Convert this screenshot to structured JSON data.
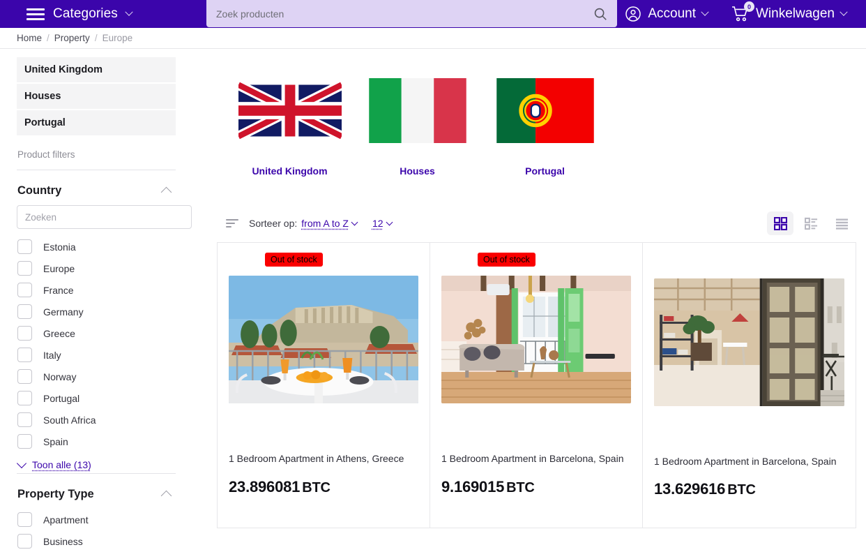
{
  "header": {
    "categories_label": "Categories",
    "menu_icon": "hamburger-icon",
    "search": {
      "placeholder": "Zoek producten",
      "value": "",
      "icon": "search-icon"
    },
    "account_label": "Account",
    "account_icon": "user-circle-icon",
    "cart_label": "Winkelwagen",
    "cart_icon": "shopping-cart-icon",
    "cart_count": "0",
    "brand_color": "#3b05ab",
    "search_bg": "#ded3f4"
  },
  "breadcrumb": {
    "items": [
      {
        "label": "Home",
        "current": false
      },
      {
        "label": "Property",
        "current": false
      },
      {
        "label": "Europe",
        "current": true
      }
    ],
    "separator": "/"
  },
  "sidebar": {
    "categories": [
      {
        "label": "United Kingdom"
      },
      {
        "label": "Houses"
      },
      {
        "label": "Portugal"
      }
    ],
    "filters_title": "Product filters",
    "facets": [
      {
        "title": "Country",
        "expanded": true,
        "search_placeholder": "Zoeken",
        "search_value": "",
        "options": [
          {
            "label": "Estonia",
            "checked": false
          },
          {
            "label": "Europe",
            "checked": false
          },
          {
            "label": "France",
            "checked": false
          },
          {
            "label": "Germany",
            "checked": false
          },
          {
            "label": "Greece",
            "checked": false
          },
          {
            "label": "Italy",
            "checked": false
          },
          {
            "label": "Norway",
            "checked": false
          },
          {
            "label": "Portugal",
            "checked": false
          },
          {
            "label": "South Africa",
            "checked": false
          },
          {
            "label": "Spain",
            "checked": false
          }
        ],
        "show_all_label": "Toon alle (13)"
      },
      {
        "title": "Property Type",
        "expanded": true,
        "options": [
          {
            "label": "Apartment",
            "checked": false
          },
          {
            "label": "Business",
            "checked": false
          }
        ]
      }
    ]
  },
  "tiles": [
    {
      "label": "United Kingdom",
      "flag": "flag-united-kingdom"
    },
    {
      "label": "Houses",
      "flag": "flag-italy"
    },
    {
      "label": "Portugal",
      "flag": "flag-portugal"
    }
  ],
  "toolbar": {
    "sort_icon": "sort-icon",
    "sort_label": "Sorteer op:",
    "sort_value": "from A to Z",
    "page_size_value": "12",
    "views": [
      {
        "name": "grid-view",
        "active": true
      },
      {
        "name": "list-view",
        "active": false
      },
      {
        "name": "compact-list-view",
        "active": false
      }
    ]
  },
  "products": [
    {
      "badge": "Out of stock",
      "title": "1 Bedroom Apartment in Athens, Greece",
      "price": "23.896081",
      "currency": "BTC",
      "image": "athens-acropolis-balcony-photo"
    },
    {
      "badge": "Out of stock",
      "title": "1 Bedroom Apartment in Barcelona, Spain",
      "price": "9.169015",
      "currency": "BTC",
      "image": "barcelona-living-room-green-doors-photo"
    },
    {
      "badge": "",
      "title": "1 Bedroom Apartment in Barcelona, Spain",
      "price": "13.629616",
      "currency": "BTC",
      "image": "barcelona-loft-terrace-photo"
    }
  ]
}
